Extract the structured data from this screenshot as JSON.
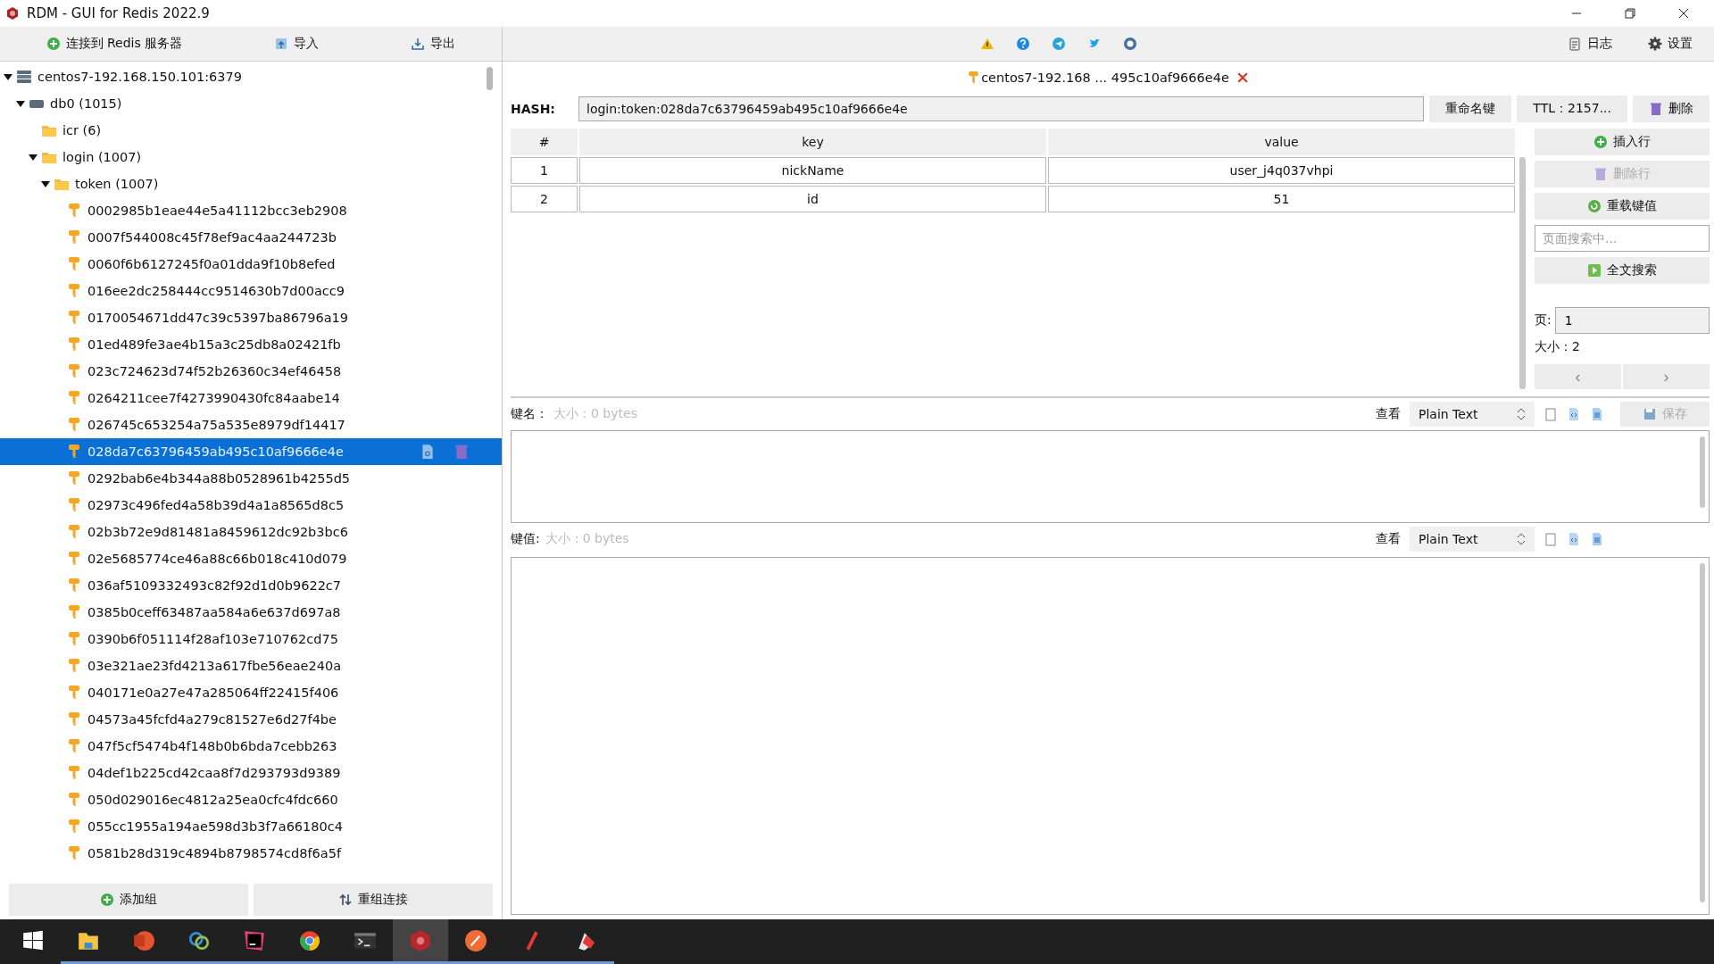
{
  "window": {
    "title": "RDM - GUI for Redis 2022.9"
  },
  "toolbar": {
    "left_buttons": [
      {
        "kind": "connect",
        "label": "连接到 Redis 服务器"
      },
      {
        "kind": "import",
        "label": "导入"
      },
      {
        "kind": "export",
        "label": "导出"
      }
    ],
    "right_buttons": [
      {
        "kind": "log",
        "label": "日志"
      },
      {
        "kind": "settings",
        "label": "设置"
      }
    ]
  },
  "tree": [
    {
      "kind": "server",
      "label": "centos7-192.168.150.101:6379",
      "expanded": true,
      "children": [
        {
          "kind": "db",
          "label": "db0  (1015)",
          "expanded": true,
          "children": [
            {
              "kind": "folder",
              "label": "icr (6)"
            },
            {
              "kind": "folder",
              "label": "login (1007)",
              "expanded": true,
              "children": [
                {
                  "kind": "folder",
                  "label": "token (1007)",
                  "expanded": true,
                  "children": [
                    {
                      "kind": "key",
                      "label": "0002985b1eae44e5a41112bcc3eb2908",
                      "selected": false
                    },
                    {
                      "kind": "key",
                      "label": "0007f544008c45f78ef9ac4aa244723b",
                      "selected": false
                    },
                    {
                      "kind": "key",
                      "label": "0060f6b6127245f0a01dda9f10b8efed",
                      "selected": false
                    },
                    {
                      "kind": "key",
                      "label": "016ee2dc258444cc9514630b7d00acc9",
                      "selected": false
                    },
                    {
                      "kind": "key",
                      "label": "0170054671dd47c39c5397ba86796a19",
                      "selected": false
                    },
                    {
                      "kind": "key",
                      "label": "01ed489fe3ae4b15a3c25db8a02421fb",
                      "selected": false
                    },
                    {
                      "kind": "key",
                      "label": "023c724623d74f52b26360c34ef46458",
                      "selected": false
                    },
                    {
                      "kind": "key",
                      "label": "0264211cee7f4273990430fc84aabe14",
                      "selected": false
                    },
                    {
                      "kind": "key",
                      "label": "026745c653254a75a535e8979df14417",
                      "selected": false
                    },
                    {
                      "kind": "key",
                      "label": "028da7c63796459ab495c10af9666e4e",
                      "selected": true
                    },
                    {
                      "kind": "key",
                      "label": "0292bab6e4b344a88b0528961b4255d5",
                      "selected": false
                    },
                    {
                      "kind": "key",
                      "label": "02973c496fed4a58b39d4a1a8565d8c5",
                      "selected": false
                    },
                    {
                      "kind": "key",
                      "label": "02b3b72e9d81481a8459612dc92b3bc6",
                      "selected": false
                    },
                    {
                      "kind": "key",
                      "label": "02e5685774ce46a88c66b018c410d079",
                      "selected": false
                    },
                    {
                      "kind": "key",
                      "label": "036af5109332493c82f92d1d0b9622c7",
                      "selected": false
                    },
                    {
                      "kind": "key",
                      "label": "0385b0ceff63487aa584a6e637d697a8",
                      "selected": false
                    },
                    {
                      "kind": "key",
                      "label": "0390b6f051114f28af103e710762cd75",
                      "selected": false
                    },
                    {
                      "kind": "key",
                      "label": "03e321ae23fd4213a617fbe56eae240a",
                      "selected": false
                    },
                    {
                      "kind": "key",
                      "label": "040171e0a27e47a285064ff22415f406",
                      "selected": false
                    },
                    {
                      "kind": "key",
                      "label": "04573a45fcfd4a279c81527e6d27f4be",
                      "selected": false
                    },
                    {
                      "kind": "key",
                      "label": "047f5cf5474b4f148b0b6bda7cebb263",
                      "selected": false
                    },
                    {
                      "kind": "key",
                      "label": "04def1b225cd42caa8f7d293793d9389",
                      "selected": false
                    },
                    {
                      "kind": "key",
                      "label": "050d029016ec4812a25ea0cfc4fdc660",
                      "selected": false
                    },
                    {
                      "kind": "key",
                      "label": "055cc1955a194ae598d3b3f7a66180c4",
                      "selected": false
                    },
                    {
                      "kind": "key",
                      "label": "0581b28d319c4894b8798574cd8f6a5f",
                      "selected": false
                    }
                  ]
                }
              ]
            }
          ]
        }
      ]
    }
  ],
  "tree_buttons": [
    {
      "kind": "add",
      "label": "添加组"
    },
    {
      "kind": "regroup",
      "label": "重组连接"
    }
  ],
  "tab": {
    "label": "centos7-192.168 ... 495c10af9666e4e"
  },
  "hash": {
    "label": "HASH:",
    "value": "login:token:028da7c63796459ab495c10af9666e4e",
    "rename": "重命名键",
    "ttl": "TTL：2157...",
    "delete": "删除"
  },
  "table": {
    "columns": [
      "#",
      "key",
      "value"
    ],
    "rows": [
      [
        "1",
        "nickName",
        "user_j4q037vhpi"
      ],
      [
        "2",
        "id",
        "51"
      ]
    ]
  },
  "side_buttons": [
    {
      "kind": "insert",
      "label": "插入行",
      "disabled": false
    },
    {
      "kind": "remove",
      "label": "删除行",
      "disabled": true
    },
    {
      "kind": "reload",
      "label": "重载键值",
      "disabled": false
    }
  ],
  "search": {
    "placeholder": "页面搜索中..."
  },
  "fulltext": {
    "label": "全文搜索"
  },
  "page": {
    "label": "页:",
    "value": "1",
    "size": "大小：2",
    "prev": "‹",
    "next": "›"
  },
  "key_editor": {
    "label": "键名：",
    "size": "大小：0 bytes",
    "view": "查看",
    "format": "Plain Text",
    "save": "保存"
  },
  "value_editor": {
    "label": "键值:",
    "size": "大小：0 bytes",
    "view": "查看",
    "format": "Plain Text"
  },
  "taskbar": [
    {
      "kind": "start",
      "selected": false
    },
    {
      "kind": "folder",
      "selected": false
    },
    {
      "kind": "slides",
      "selected": false
    },
    {
      "kind": "rings",
      "selected": false
    },
    {
      "kind": "ide",
      "selected": false
    },
    {
      "kind": "browser",
      "selected": false
    },
    {
      "kind": "terminal",
      "selected": false
    },
    {
      "kind": "redis",
      "selected": true
    },
    {
      "kind": "orange",
      "selected": false
    },
    {
      "kind": "pen",
      "selected": false
    },
    {
      "kind": "paint",
      "selected": false
    }
  ]
}
